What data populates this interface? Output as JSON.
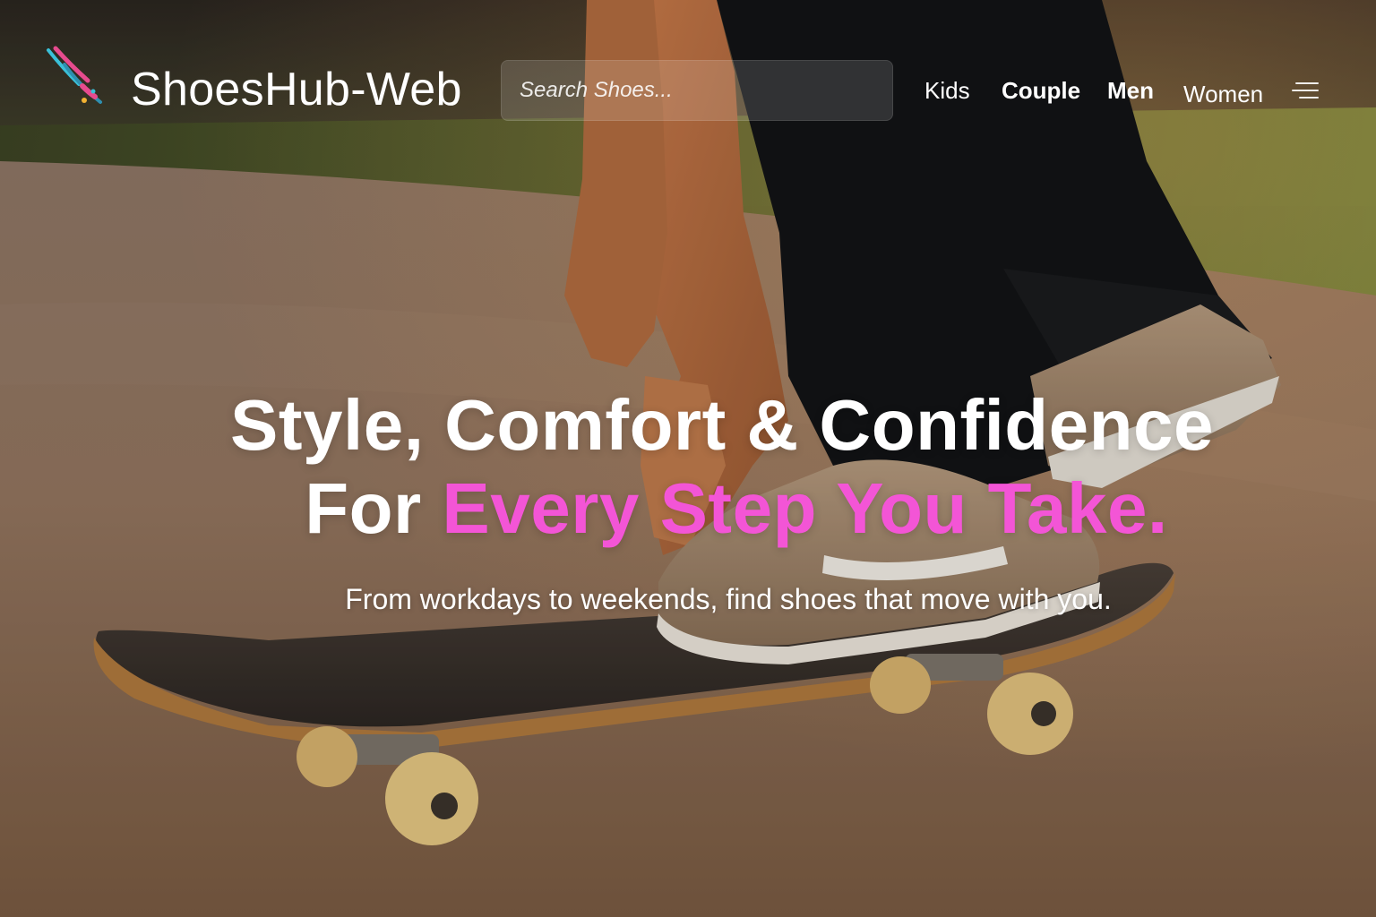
{
  "brand": {
    "name": "ShoesHub-Web",
    "logo_icon": "skateboard-swoosh-logo"
  },
  "search": {
    "placeholder": "Search Shoes..."
  },
  "nav": {
    "items": [
      {
        "label": "Kids"
      },
      {
        "label": "Couple"
      },
      {
        "label": "Men"
      },
      {
        "label": "Women"
      }
    ],
    "menu_icon": "hamburger-menu-icon"
  },
  "hero": {
    "headline_line1": "Style, Comfort & Confidence",
    "headline_line2_prefix": "For",
    "headline_line2_accent": "Every Step You Take.",
    "subtitle": "From workdays to weekends, find shoes that move with you.",
    "background_image": "person crouching on a skateboard wearing canvas sneakers at sunset"
  },
  "colors": {
    "accent": "#f355d6",
    "text": "#ffffff"
  }
}
